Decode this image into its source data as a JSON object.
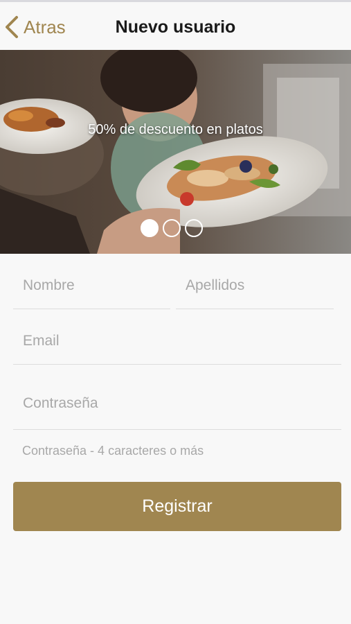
{
  "theme": {
    "accent": "#a08650"
  },
  "nav": {
    "back_label": "Atras",
    "title": "Nuevo usuario",
    "back_icon": "chevron-left-icon"
  },
  "hero": {
    "caption": "50% de descuento en platos",
    "page_count": 3,
    "active_page": 1
  },
  "form": {
    "first_name_placeholder": "Nombre",
    "last_name_placeholder": "Apellidos",
    "email_placeholder": "Email",
    "password_placeholder": "Contraseña",
    "password_hint": "Contraseña - 4 caracteres o más",
    "submit_label": "Registrar"
  }
}
